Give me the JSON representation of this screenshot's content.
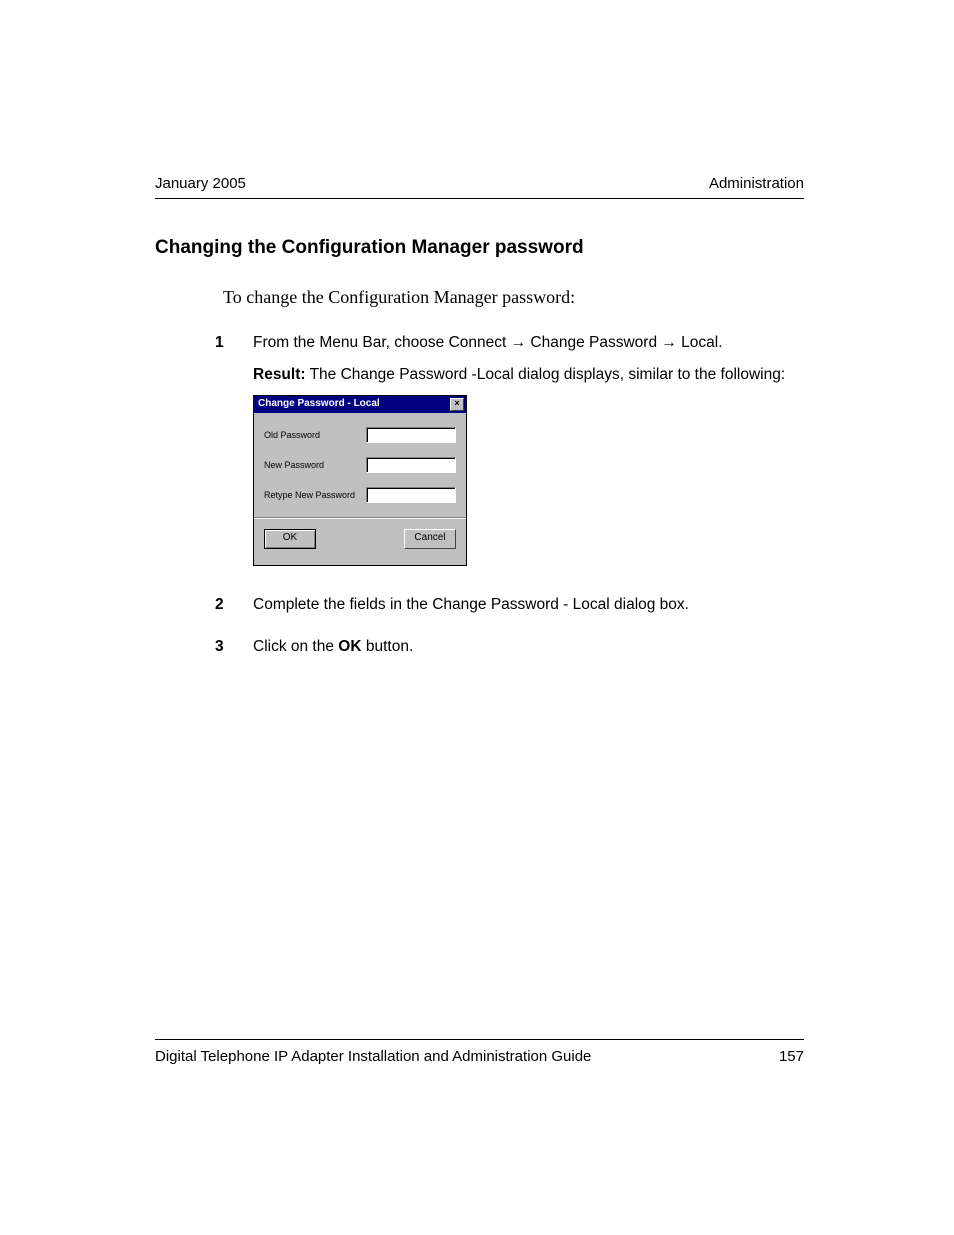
{
  "header": {
    "left": "January 2005",
    "right": "Administration"
  },
  "title": "Changing the Configuration Manager password",
  "intro": "To change the Configuration Manager password:",
  "steps": [
    {
      "num": "1",
      "text": "From the Menu Bar, choose Connect → Change Password → Local.",
      "result_label": "Result:",
      "result_text": " The Change Password -Local dialog displays, similar to the following:"
    },
    {
      "num": "2",
      "text": "Complete the fields in the Change Password - Local dialog box."
    },
    {
      "num": "3",
      "text_pre": "Click on the ",
      "bold": "OK",
      "text_post": " button."
    }
  ],
  "dialog": {
    "title": "Change Password - Local",
    "close": "×",
    "fields": [
      {
        "label": "Old Password"
      },
      {
        "label": "New Password"
      },
      {
        "label": "Retype New Password"
      }
    ],
    "ok": "OK",
    "cancel": "Cancel"
  },
  "footer": {
    "left": "Digital Telephone IP Adapter Installation and Administration Guide",
    "right": "157"
  }
}
